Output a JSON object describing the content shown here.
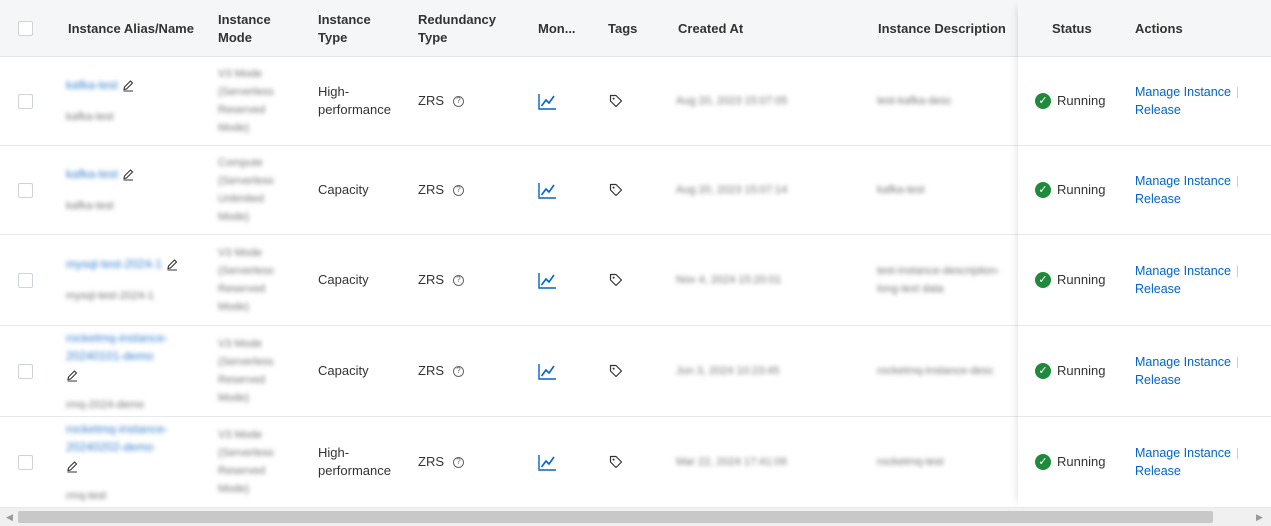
{
  "columns": {
    "alias": "Instance Alias/Name",
    "mode": "Instance\nMode",
    "type": "Instance\nType",
    "redundancy": "Redundancy\nType",
    "monitor": "Mon...",
    "tags": "Tags",
    "created": "Created At",
    "description": "Instance Description",
    "status": "Status",
    "actions": "Actions"
  },
  "rows": [
    {
      "alias": "kafka-test",
      "name": "kafka-test",
      "mode": "V3 Mode (Serverless Reserved Mode)",
      "type": "High-\nperformance",
      "redundancy": "ZRS",
      "created": "Aug 20, 2023 15:07:05",
      "description": "test-kafka-desc",
      "status": "Running",
      "manage": "Manage Instance",
      "release": "Release"
    },
    {
      "alias": "kafka-test",
      "name": "kafka-test",
      "mode": "Compute (Serverless Unlimited Mode)",
      "type": "Capacity",
      "redundancy": "ZRS",
      "created": "Aug 20, 2023 15:07:14",
      "description": "kafka-test",
      "status": "Running",
      "manage": "Manage Instance",
      "release": "Release"
    },
    {
      "alias": "mysql-test-2024-1",
      "name": "mysql-test-2024-1",
      "mode": "V3 Mode (Serverless Reserved Mode)",
      "type": "Capacity",
      "redundancy": "ZRS",
      "created": "Nov 4, 2024 15:20:01",
      "description": "test-instance-description-long-text data",
      "status": "Running",
      "manage": "Manage Instance",
      "release": "Release"
    },
    {
      "alias": "rocketmq-instance-20240101-demo",
      "name": "rmq-2024-demo",
      "mode": "V3 Mode (Serverless Reserved Mode)",
      "type": "Capacity",
      "redundancy": "ZRS",
      "created": "Jun 3, 2024 10:23:45",
      "description": "rocketmq-instance-desc",
      "status": "Running",
      "manage": "Manage Instance",
      "release": "Release"
    },
    {
      "alias": "rocketmq-instance-20240202-demo",
      "name": "rmq-test",
      "mode": "V3 Mode (Serverless Reserved Mode)",
      "type": "High-\nperformance",
      "redundancy": "ZRS",
      "created": "Mar 22, 2024 17:41:09",
      "description": "rocketmq-test",
      "status": "Running",
      "manage": "Manage Instance",
      "release": "Release"
    }
  ],
  "icons": {
    "edit": "pencil-icon",
    "monitor": "line-chart-icon",
    "tag": "tag-icon",
    "help": "question-circle-icon",
    "status": "check-circle-icon"
  },
  "colors": {
    "link": "#0064c8",
    "running": "#1f8a3b",
    "header_bg": "#f5f6f8"
  }
}
